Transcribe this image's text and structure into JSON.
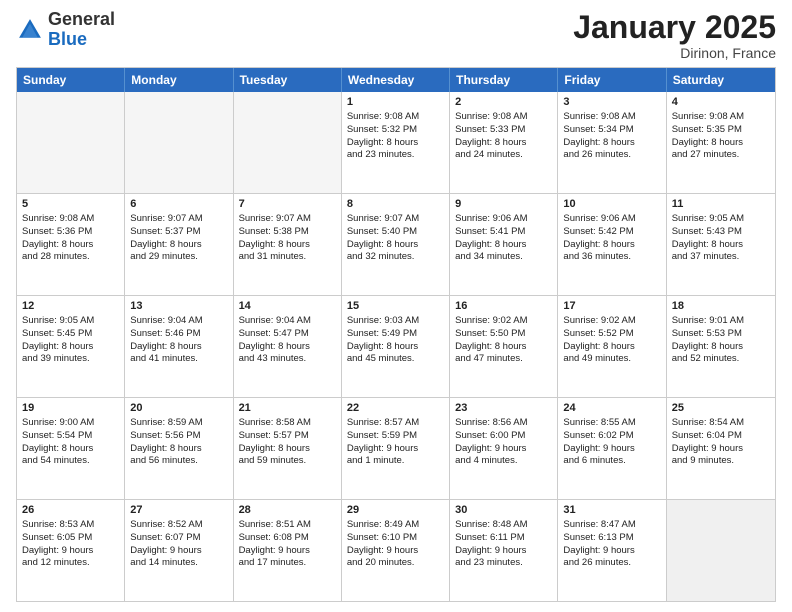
{
  "header": {
    "logo_general": "General",
    "logo_blue": "Blue",
    "month_title": "January 2025",
    "location": "Dirinon, France"
  },
  "days_of_week": [
    "Sunday",
    "Monday",
    "Tuesday",
    "Wednesday",
    "Thursday",
    "Friday",
    "Saturday"
  ],
  "weeks": [
    [
      {
        "day": "",
        "empty": true
      },
      {
        "day": "",
        "empty": true
      },
      {
        "day": "",
        "empty": true
      },
      {
        "day": "1",
        "lines": [
          "Sunrise: 9:08 AM",
          "Sunset: 5:32 PM",
          "Daylight: 8 hours",
          "and 23 minutes."
        ]
      },
      {
        "day": "2",
        "lines": [
          "Sunrise: 9:08 AM",
          "Sunset: 5:33 PM",
          "Daylight: 8 hours",
          "and 24 minutes."
        ]
      },
      {
        "day": "3",
        "lines": [
          "Sunrise: 9:08 AM",
          "Sunset: 5:34 PM",
          "Daylight: 8 hours",
          "and 26 minutes."
        ]
      },
      {
        "day": "4",
        "lines": [
          "Sunrise: 9:08 AM",
          "Sunset: 5:35 PM",
          "Daylight: 8 hours",
          "and 27 minutes."
        ]
      }
    ],
    [
      {
        "day": "5",
        "lines": [
          "Sunrise: 9:08 AM",
          "Sunset: 5:36 PM",
          "Daylight: 8 hours",
          "and 28 minutes."
        ]
      },
      {
        "day": "6",
        "lines": [
          "Sunrise: 9:07 AM",
          "Sunset: 5:37 PM",
          "Daylight: 8 hours",
          "and 29 minutes."
        ]
      },
      {
        "day": "7",
        "lines": [
          "Sunrise: 9:07 AM",
          "Sunset: 5:38 PM",
          "Daylight: 8 hours",
          "and 31 minutes."
        ]
      },
      {
        "day": "8",
        "lines": [
          "Sunrise: 9:07 AM",
          "Sunset: 5:40 PM",
          "Daylight: 8 hours",
          "and 32 minutes."
        ]
      },
      {
        "day": "9",
        "lines": [
          "Sunrise: 9:06 AM",
          "Sunset: 5:41 PM",
          "Daylight: 8 hours",
          "and 34 minutes."
        ]
      },
      {
        "day": "10",
        "lines": [
          "Sunrise: 9:06 AM",
          "Sunset: 5:42 PM",
          "Daylight: 8 hours",
          "and 36 minutes."
        ]
      },
      {
        "day": "11",
        "lines": [
          "Sunrise: 9:05 AM",
          "Sunset: 5:43 PM",
          "Daylight: 8 hours",
          "and 37 minutes."
        ]
      }
    ],
    [
      {
        "day": "12",
        "lines": [
          "Sunrise: 9:05 AM",
          "Sunset: 5:45 PM",
          "Daylight: 8 hours",
          "and 39 minutes."
        ]
      },
      {
        "day": "13",
        "lines": [
          "Sunrise: 9:04 AM",
          "Sunset: 5:46 PM",
          "Daylight: 8 hours",
          "and 41 minutes."
        ]
      },
      {
        "day": "14",
        "lines": [
          "Sunrise: 9:04 AM",
          "Sunset: 5:47 PM",
          "Daylight: 8 hours",
          "and 43 minutes."
        ]
      },
      {
        "day": "15",
        "lines": [
          "Sunrise: 9:03 AM",
          "Sunset: 5:49 PM",
          "Daylight: 8 hours",
          "and 45 minutes."
        ]
      },
      {
        "day": "16",
        "lines": [
          "Sunrise: 9:02 AM",
          "Sunset: 5:50 PM",
          "Daylight: 8 hours",
          "and 47 minutes."
        ]
      },
      {
        "day": "17",
        "lines": [
          "Sunrise: 9:02 AM",
          "Sunset: 5:52 PM",
          "Daylight: 8 hours",
          "and 49 minutes."
        ]
      },
      {
        "day": "18",
        "lines": [
          "Sunrise: 9:01 AM",
          "Sunset: 5:53 PM",
          "Daylight: 8 hours",
          "and 52 minutes."
        ]
      }
    ],
    [
      {
        "day": "19",
        "lines": [
          "Sunrise: 9:00 AM",
          "Sunset: 5:54 PM",
          "Daylight: 8 hours",
          "and 54 minutes."
        ]
      },
      {
        "day": "20",
        "lines": [
          "Sunrise: 8:59 AM",
          "Sunset: 5:56 PM",
          "Daylight: 8 hours",
          "and 56 minutes."
        ]
      },
      {
        "day": "21",
        "lines": [
          "Sunrise: 8:58 AM",
          "Sunset: 5:57 PM",
          "Daylight: 8 hours",
          "and 59 minutes."
        ]
      },
      {
        "day": "22",
        "lines": [
          "Sunrise: 8:57 AM",
          "Sunset: 5:59 PM",
          "Daylight: 9 hours",
          "and 1 minute."
        ]
      },
      {
        "day": "23",
        "lines": [
          "Sunrise: 8:56 AM",
          "Sunset: 6:00 PM",
          "Daylight: 9 hours",
          "and 4 minutes."
        ]
      },
      {
        "day": "24",
        "lines": [
          "Sunrise: 8:55 AM",
          "Sunset: 6:02 PM",
          "Daylight: 9 hours",
          "and 6 minutes."
        ]
      },
      {
        "day": "25",
        "lines": [
          "Sunrise: 8:54 AM",
          "Sunset: 6:04 PM",
          "Daylight: 9 hours",
          "and 9 minutes."
        ]
      }
    ],
    [
      {
        "day": "26",
        "lines": [
          "Sunrise: 8:53 AM",
          "Sunset: 6:05 PM",
          "Daylight: 9 hours",
          "and 12 minutes."
        ]
      },
      {
        "day": "27",
        "lines": [
          "Sunrise: 8:52 AM",
          "Sunset: 6:07 PM",
          "Daylight: 9 hours",
          "and 14 minutes."
        ]
      },
      {
        "day": "28",
        "lines": [
          "Sunrise: 8:51 AM",
          "Sunset: 6:08 PM",
          "Daylight: 9 hours",
          "and 17 minutes."
        ]
      },
      {
        "day": "29",
        "lines": [
          "Sunrise: 8:49 AM",
          "Sunset: 6:10 PM",
          "Daylight: 9 hours",
          "and 20 minutes."
        ]
      },
      {
        "day": "30",
        "lines": [
          "Sunrise: 8:48 AM",
          "Sunset: 6:11 PM",
          "Daylight: 9 hours",
          "and 23 minutes."
        ]
      },
      {
        "day": "31",
        "lines": [
          "Sunrise: 8:47 AM",
          "Sunset: 6:13 PM",
          "Daylight: 9 hours",
          "and 26 minutes."
        ]
      },
      {
        "day": "",
        "empty": true,
        "shaded": true
      }
    ]
  ]
}
